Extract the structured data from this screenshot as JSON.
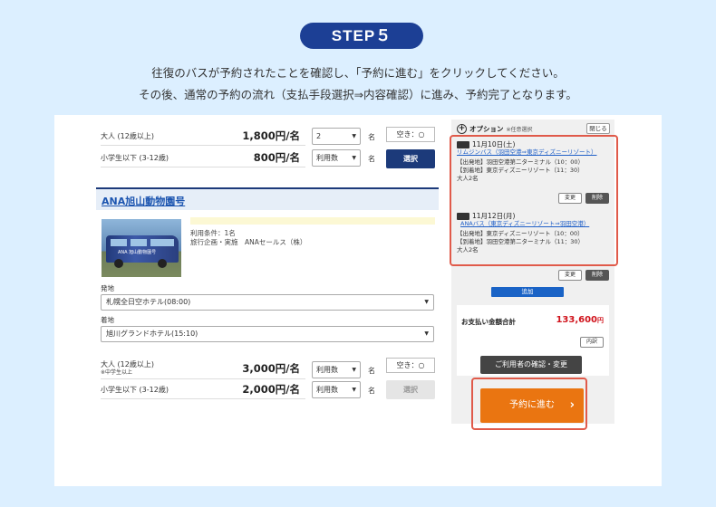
{
  "step_label": "STEP５",
  "instructions": {
    "line1": "往復のバスが予約されたことを確認し、「予約に進む」をクリックしてください。",
    "line2": "その後、通常の予約の流れ（支払手段選択⇒内容確認）に進み、予約完了となります。"
  },
  "upper_fares": [
    {
      "label": "大人 (12歳以上)",
      "sublabel": "",
      "price": "1,800円/名",
      "qty": "2",
      "unit": "名",
      "vacancy": "空き：○",
      "select": "選択"
    },
    {
      "label": "小学生以下 (3-12歳)",
      "sublabel": "",
      "price": "800円/名",
      "qty": "利用数",
      "unit": "名"
    }
  ],
  "section": {
    "title": "ANA旭山動物園号",
    "bus_sign": "ANA 旭山動物園号",
    "conditions_line1": "利用条件：1名",
    "conditions_line2": "旅行企画・実施　ANAセールス（株）",
    "departure_label": "発地",
    "departure_value": "札幌全日空ホテル(08:00)",
    "arrival_label": "着地",
    "arrival_value": "旭川グランドホテル(15:10)"
  },
  "lower_fares": [
    {
      "label": "大人 (12歳以上)",
      "sublabel": "※中学生以上",
      "price": "3,000円/名",
      "qty": "利用数",
      "unit": "名",
      "vacancy": "空き：○",
      "select": "選択"
    },
    {
      "label": "小学生以下 (3-12歳)",
      "sublabel": "",
      "price": "2,000円/名",
      "qty": "利用数",
      "unit": "名"
    }
  ],
  "options": {
    "header": "オプション",
    "header_sub": "※任意選択",
    "close": "閉じる",
    "items": [
      {
        "date": "11月10日(土)",
        "route": "リムジンバス（羽田空港⇒東京ディズニーリゾート）",
        "dep": "【出発地】羽田空港第二ターミナル（10：00）",
        "arr": "【到着地】東京ディズニーリゾート（11：30）",
        "pax": "大人2名",
        "change": "変更",
        "delete": "削除"
      },
      {
        "date": "11月12日(月)",
        "route": "ANAバス（東京ディズニーリゾート⇒羽田空港）",
        "dep": "【出発地】東京ディズニーリゾート（10：00）",
        "arr": "【到着地】羽田空港第二ターミナル（11：30）",
        "pax": "大人2名",
        "change": "変更",
        "delete": "削除"
      }
    ],
    "add": "追加"
  },
  "payment": {
    "label": "お支払い金額合計",
    "amount": "133,600",
    "currency": "円",
    "breakdown": "内訳",
    "confirm": "ご利用者の確認・変更"
  },
  "reserve": {
    "label": "予約に進む",
    "chevron": "›"
  },
  "colors": {
    "step_pill": "#1c3f95",
    "accent_orange": "#ea7511",
    "highlight_red": "#e05a4a",
    "total_red": "#d0121b"
  }
}
